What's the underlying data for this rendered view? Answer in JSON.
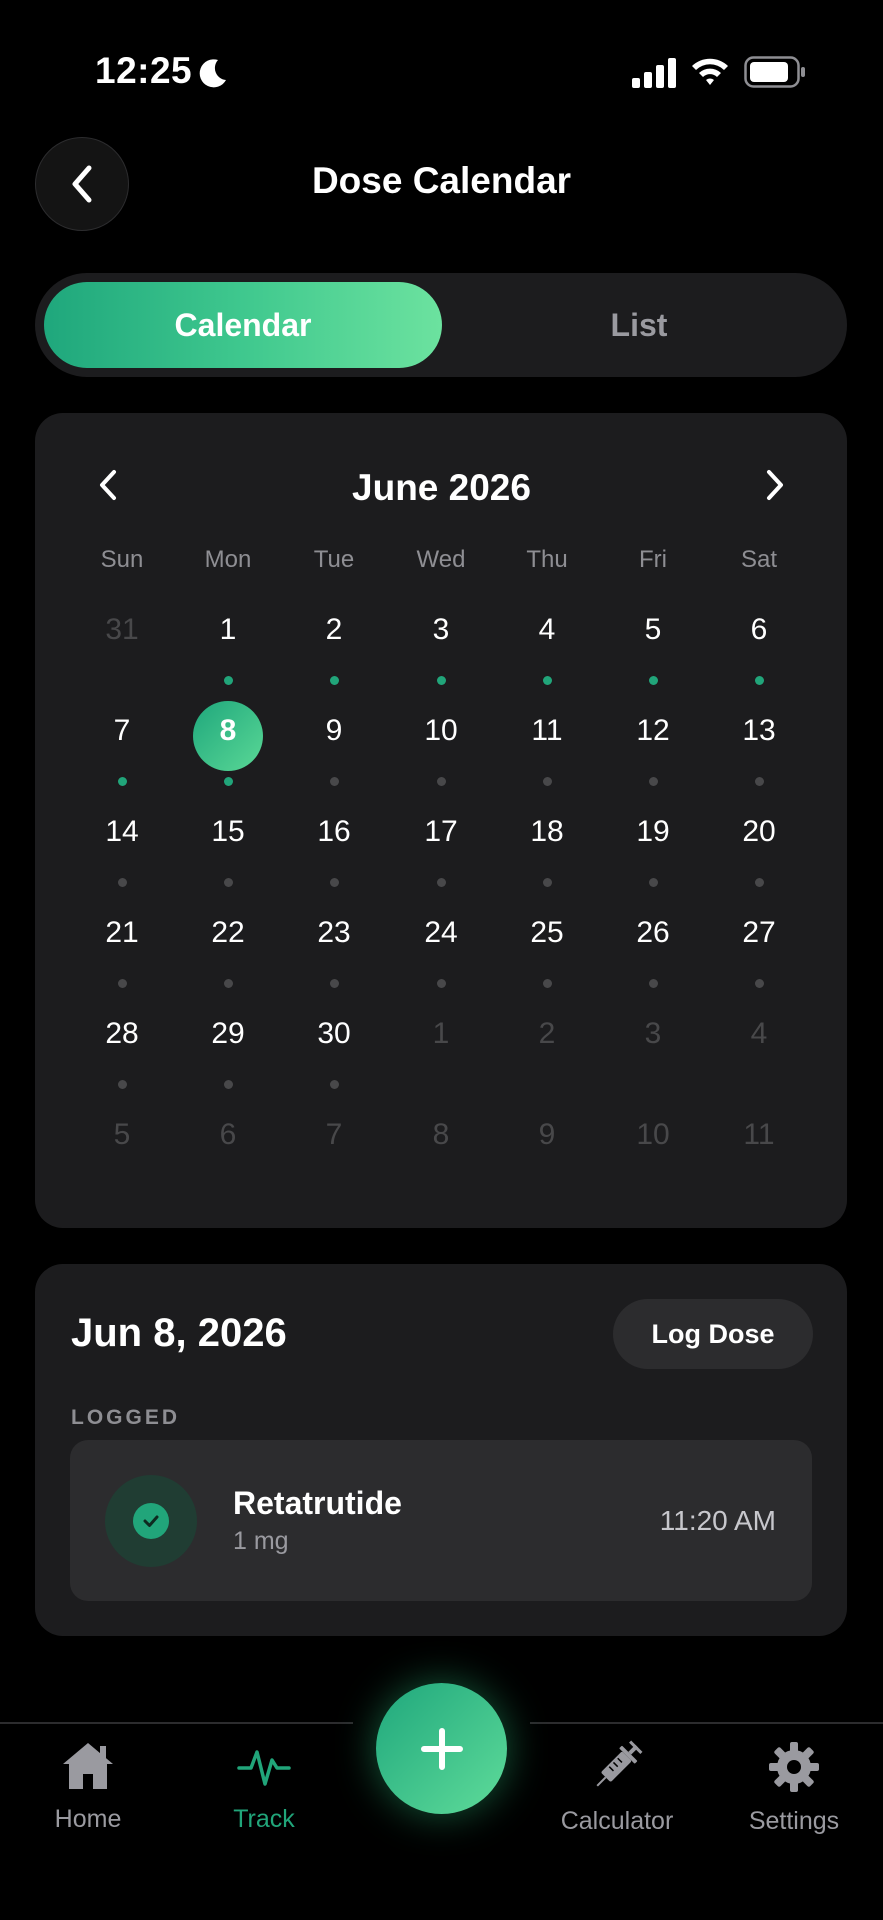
{
  "status_bar": {
    "time": "12:25",
    "icons": [
      "moon-icon",
      "signal-icon",
      "wifi-icon",
      "battery-icon"
    ]
  },
  "header": {
    "title": "Dose Calendar",
    "back_icon": "chevron-left-icon"
  },
  "segmented": {
    "options": [
      "Calendar",
      "List"
    ],
    "selected": "Calendar"
  },
  "calendar": {
    "month_label": "June 2026",
    "weekdays": [
      "Sun",
      "Mon",
      "Tue",
      "Wed",
      "Thu",
      "Fri",
      "Sat"
    ],
    "selected_day": "8",
    "weeks": [
      [
        {
          "d": "31",
          "m": true,
          "dot": "none"
        },
        {
          "d": "1",
          "m": false,
          "dot": "green"
        },
        {
          "d": "2",
          "m": false,
          "dot": "green"
        },
        {
          "d": "3",
          "m": false,
          "dot": "green"
        },
        {
          "d": "4",
          "m": false,
          "dot": "green"
        },
        {
          "d": "5",
          "m": false,
          "dot": "green"
        },
        {
          "d": "6",
          "m": false,
          "dot": "green"
        }
      ],
      [
        {
          "d": "7",
          "m": false,
          "dot": "green"
        },
        {
          "d": "8",
          "m": false,
          "dot": "green",
          "sel": true
        },
        {
          "d": "9",
          "m": false,
          "dot": "gray"
        },
        {
          "d": "10",
          "m": false,
          "dot": "gray"
        },
        {
          "d": "11",
          "m": false,
          "dot": "gray"
        },
        {
          "d": "12",
          "m": false,
          "dot": "gray"
        },
        {
          "d": "13",
          "m": false,
          "dot": "gray"
        }
      ],
      [
        {
          "d": "14",
          "m": false,
          "dot": "gray"
        },
        {
          "d": "15",
          "m": false,
          "dot": "gray"
        },
        {
          "d": "16",
          "m": false,
          "dot": "gray"
        },
        {
          "d": "17",
          "m": false,
          "dot": "gray"
        },
        {
          "d": "18",
          "m": false,
          "dot": "gray"
        },
        {
          "d": "19",
          "m": false,
          "dot": "gray"
        },
        {
          "d": "20",
          "m": false,
          "dot": "gray"
        }
      ],
      [
        {
          "d": "21",
          "m": false,
          "dot": "gray"
        },
        {
          "d": "22",
          "m": false,
          "dot": "gray"
        },
        {
          "d": "23",
          "m": false,
          "dot": "gray"
        },
        {
          "d": "24",
          "m": false,
          "dot": "gray"
        },
        {
          "d": "25",
          "m": false,
          "dot": "gray"
        },
        {
          "d": "26",
          "m": false,
          "dot": "gray"
        },
        {
          "d": "27",
          "m": false,
          "dot": "gray"
        }
      ],
      [
        {
          "d": "28",
          "m": false,
          "dot": "gray"
        },
        {
          "d": "29",
          "m": false,
          "dot": "gray"
        },
        {
          "d": "30",
          "m": false,
          "dot": "gray"
        },
        {
          "d": "1",
          "m": true,
          "dot": "none"
        },
        {
          "d": "2",
          "m": true,
          "dot": "none"
        },
        {
          "d": "3",
          "m": true,
          "dot": "none"
        },
        {
          "d": "4",
          "m": true,
          "dot": "none"
        }
      ],
      [
        {
          "d": "5",
          "m": true,
          "dot": "none"
        },
        {
          "d": "6",
          "m": true,
          "dot": "none"
        },
        {
          "d": "7",
          "m": true,
          "dot": "none"
        },
        {
          "d": "8",
          "m": true,
          "dot": "none"
        },
        {
          "d": "9",
          "m": true,
          "dot": "none"
        },
        {
          "d": "10",
          "m": true,
          "dot": "none"
        },
        {
          "d": "11",
          "m": true,
          "dot": "none"
        }
      ]
    ]
  },
  "day_detail": {
    "date": "Jun 8, 2026",
    "log_button": "Log Dose",
    "section_label": "LOGGED",
    "entries": [
      {
        "name": "Retatrutide",
        "dose": "1 mg",
        "time": "11:20 AM",
        "icon": "check-icon"
      }
    ]
  },
  "tab_bar": {
    "items": [
      {
        "label": "Home",
        "icon": "home-icon"
      },
      {
        "label": "Track",
        "icon": "activity-icon",
        "active": true
      },
      {
        "label": "Calculator",
        "icon": "syringe-icon"
      },
      {
        "label": "Settings",
        "icon": "gear-icon"
      }
    ],
    "fab_icon": "plus-icon"
  },
  "colors": {
    "accent": "#21a57a",
    "accent_light": "#6ce29f",
    "card": "#1c1c1e",
    "background": "#000000"
  }
}
